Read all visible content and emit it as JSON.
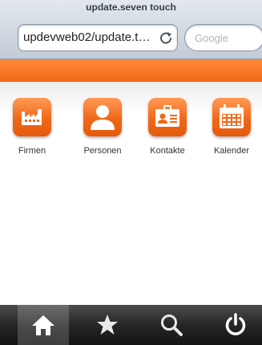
{
  "browser": {
    "title": "update.seven touch",
    "url": "updevweb02/update.t…",
    "search_placeholder": "Google"
  },
  "colors": {
    "accent": "#f26a14",
    "tab_bar": "#262626"
  },
  "tiles": [
    {
      "label": "Firmen",
      "icon": "factory-icon"
    },
    {
      "label": "Personen",
      "icon": "person-icon"
    },
    {
      "label": "Kontakte",
      "icon": "id-card-icon"
    },
    {
      "label": "Kalender",
      "icon": "calendar-icon"
    }
  ],
  "tab_bar": [
    {
      "icon": "home-icon",
      "active": true
    },
    {
      "icon": "star-icon",
      "active": false
    },
    {
      "icon": "search-icon",
      "active": false
    },
    {
      "icon": "power-icon",
      "active": false
    }
  ]
}
